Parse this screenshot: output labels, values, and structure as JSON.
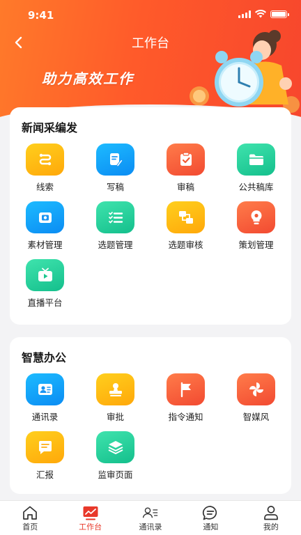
{
  "status_bar": {
    "time": "9:41"
  },
  "header": {
    "title": "工作台",
    "slogan": "助力高效工作"
  },
  "sections": [
    {
      "title": "新闻采编发",
      "items": [
        {
          "label": "线索",
          "icon": "clue-icon",
          "color": "#ffb30f"
        },
        {
          "label": "写稿",
          "icon": "write-icon",
          "color": "#0f9bf6"
        },
        {
          "label": "审稿",
          "icon": "review-clipboard-icon",
          "color": "#f3512f"
        },
        {
          "label": "公共稿库",
          "icon": "folder-icon",
          "color": "#19c48f"
        },
        {
          "label": "素材管理",
          "icon": "material-icon",
          "color": "#0f9bf6"
        },
        {
          "label": "选题管理",
          "icon": "list-check-icon",
          "color": "#19c48f"
        },
        {
          "label": "选题审核",
          "icon": "topic-review-icon",
          "color": "#ffb30f"
        },
        {
          "label": "策划管理",
          "icon": "lightbulb-icon",
          "color": "#f3512f"
        },
        {
          "label": "直播平台",
          "icon": "tv-play-icon",
          "color": "#19c48f"
        }
      ]
    },
    {
      "title": "智慧办公",
      "items": [
        {
          "label": "通讯录",
          "icon": "contact-card-icon",
          "color": "#0f9bf6"
        },
        {
          "label": "审批",
          "icon": "stamp-icon",
          "color": "#ffb30f"
        },
        {
          "label": "指令通知",
          "icon": "flag-icon",
          "color": "#f3512f"
        },
        {
          "label": "智媒风",
          "icon": "pinwheel-icon",
          "color": "#f3512f"
        },
        {
          "label": "汇报",
          "icon": "report-chat-icon",
          "color": "#ffb30f"
        },
        {
          "label": "监审页面",
          "icon": "layers-icon",
          "color": "#19c48f"
        }
      ]
    }
  ],
  "tabbar": {
    "active": "工作台",
    "accent": "#e8382a",
    "items": [
      {
        "label": "首页",
        "icon": "home-icon"
      },
      {
        "label": "工作台",
        "icon": "workbench-icon"
      },
      {
        "label": "通讯录",
        "icon": "contacts-icon"
      },
      {
        "label": "通知",
        "icon": "message-icon"
      },
      {
        "label": "我的",
        "icon": "profile-icon"
      }
    ]
  }
}
